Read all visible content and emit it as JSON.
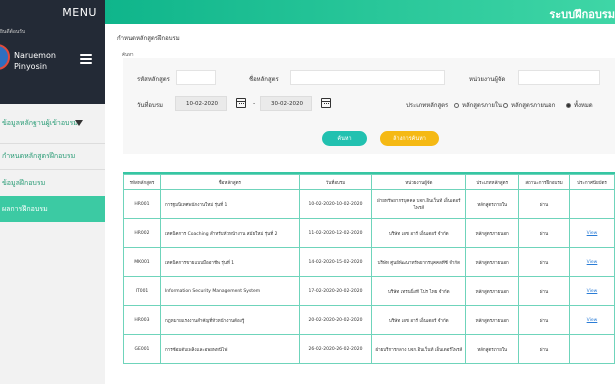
{
  "sidebar": {
    "menu_label": "MENU",
    "small_label": "ยินดีต้อนรับ",
    "user_first": "Naruemon",
    "user_last": "Pinyosin",
    "items": [
      {
        "label": "ข้อมูลหลักฐานผู้เข้าอบรม"
      },
      {
        "label": "กำหนดหลักสูตรฝึกอบรม"
      },
      {
        "label": "ข้อมูลฝึกอบรม"
      },
      {
        "label": "ผลการฝึกอบรม"
      }
    ]
  },
  "header": {
    "title": "ระบบฝึกอบรม"
  },
  "breadcrumb": "กำหนดหลักสูตรฝึกอบรม",
  "search": {
    "panel_label": "ค้นหา",
    "course_code_label": "รหัสหลักสูตร",
    "course_code_value": "",
    "course_name_label": "ชื่อหลักสูตร",
    "course_name_value": "",
    "agency_label": "หน่วยงานผู้จัด",
    "agency_value": "",
    "date_label": "วันที่อบรม",
    "date_from": "10-02-2020",
    "date_sep": "-",
    "date_to": "30-02-2020",
    "type_label": "ประเภทหลักสูตร",
    "types": [
      {
        "label": "หลักสูตรภายใน",
        "checked": false
      },
      {
        "label": "หลักสูตรภายนอก",
        "checked": false
      },
      {
        "label": "ทั้งหมด",
        "checked": true
      }
    ],
    "search_button": "ค้นหา",
    "reset_button": "ล้างการค้นหา"
  },
  "table": {
    "headers": [
      "รหัสหลักสูตร",
      "ชื่อหลักสูตร",
      "วันที่อบรม",
      "หน่วยงานผู้จัด",
      "ประเภทหลักสูตร",
      "สถานะการฝึกอบรม",
      "ประกาศนียบัตร"
    ],
    "rows": [
      {
        "code": "HR001",
        "name": "การฐมนิเทศพนักงานใหม่ รุ่นที่ 1",
        "date": "10-02-2020-10-02-2020",
        "agency": "ฝ่ายทรัพยากรบุคคล บจก.อินเว็นท์ เอ็นเตอร์ไพรส์",
        "type": "หลักสูตรภายใน",
        "status": "ผ่าน",
        "cert": ""
      },
      {
        "code": "HR002",
        "name": "เทคนิคการ Coaching สำหรับหัวหน้างาน สมัยใหม่ รุ่นที่ 2",
        "date": "11-02-2020-12-02-2020",
        "agency": "บริษัท เอช อาร์ เอ็นเตอร์ จำกัด",
        "type": "หลักสูตรภายนอก",
        "status": "ผ่าน",
        "cert": "View"
      },
      {
        "code": "MK001",
        "name": "เทคนิคการขายแบบมืออาชีพ รุ่นที่ 1",
        "date": "14-02-2020-15-02-2020",
        "agency": "บริษัท ศูนย์พัฒนาทรัพยากรบุคคลทีซี จำกัด",
        "type": "หลักสูตรภายนอก",
        "status": "ผ่าน",
        "cert": "View"
      },
      {
        "code": "IT001",
        "name": "Information Security Management System",
        "date": "17-02-2020-20-02-2020",
        "agency": "บริษัท เทรนนิ่งที โปร ไทย จำกัด",
        "type": "หลักสูตรภายนอก",
        "status": "ผ่าน",
        "cert": "View"
      },
      {
        "code": "HR003",
        "name": "กฎหมายแรงงานสำคัญที่หัวหน้างานต้องรู้",
        "date": "20-02-2020-20-02-2020",
        "agency": "บริษัท เอช อาร์ เอ็นเตอร์ จำกัด",
        "type": "หลักสูตรภายนอก",
        "status": "ผ่าน",
        "cert": "View"
      },
      {
        "code": "GE001",
        "name": "การซ้อมดับเพลิงและอพยพหนีไฟ",
        "date": "26-02-2020-26-02-2020",
        "agency": "ฝ่ายบริการกลาง บจก.อินเว็นท์ เอ็นเตอร์ไพรส์",
        "type": "หลักสูตรภายใน",
        "status": "ผ่าน",
        "cert": ""
      }
    ]
  }
}
